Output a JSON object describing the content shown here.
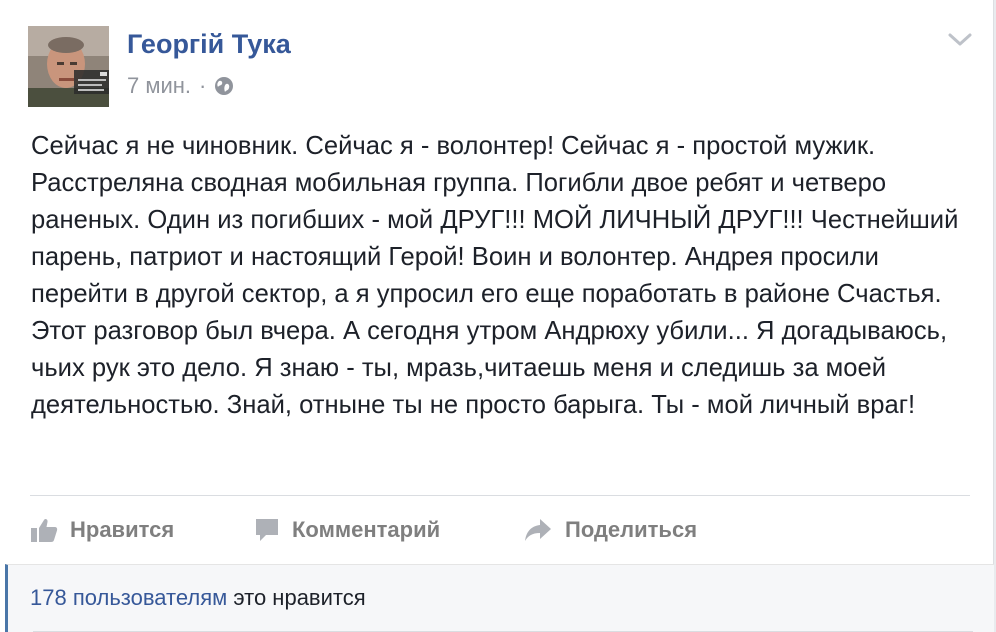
{
  "post": {
    "author": "Георгій Тука",
    "time": "7 мин.",
    "separator": "·",
    "privacy_icon": "globe-icon",
    "menu_icon": "chevron-down-icon",
    "text": "Сейчас я не чиновник. Сейчас я - волонтер! Сейчас я - простой мужик. Расстреляна сводная мобильная группа. Погибли двое ребят и четверо раненых. Один из погибших - мой ДРУГ!!! МОЙ ЛИЧНЫЙ ДРУГ!!! Честнейший парень, патриот и настоящий Герой! Воин и волонтер. Андрея просили перейти в другой сектор, а я упросил его еще поработать в районе Счастья. Этот разговор был вчера. А сегодня утром Андрюху убили... Я догадываюсь, чьих рук это дело. Я знаю - ты, мразь,читаешь меня и следишь за моей деятельностью. Знай, отныне ты не просто барыга. Ты - мой личный враг!"
  },
  "actions": {
    "like_label": "Нравится",
    "comment_label": "Комментарий",
    "share_label": "Поделиться",
    "like_icon": "thumbs-up-icon",
    "comment_icon": "comment-bubble-icon",
    "share_icon": "share-arrow-icon"
  },
  "likes": {
    "count_text": "178 пользователям",
    "suffix_text": "это нравится"
  },
  "colors": {
    "link_blue": "#365899",
    "text": "#1d2129",
    "muted": "#90949c",
    "action_gray": "#7f7f7f",
    "accent_bar": "#4a76a8"
  }
}
